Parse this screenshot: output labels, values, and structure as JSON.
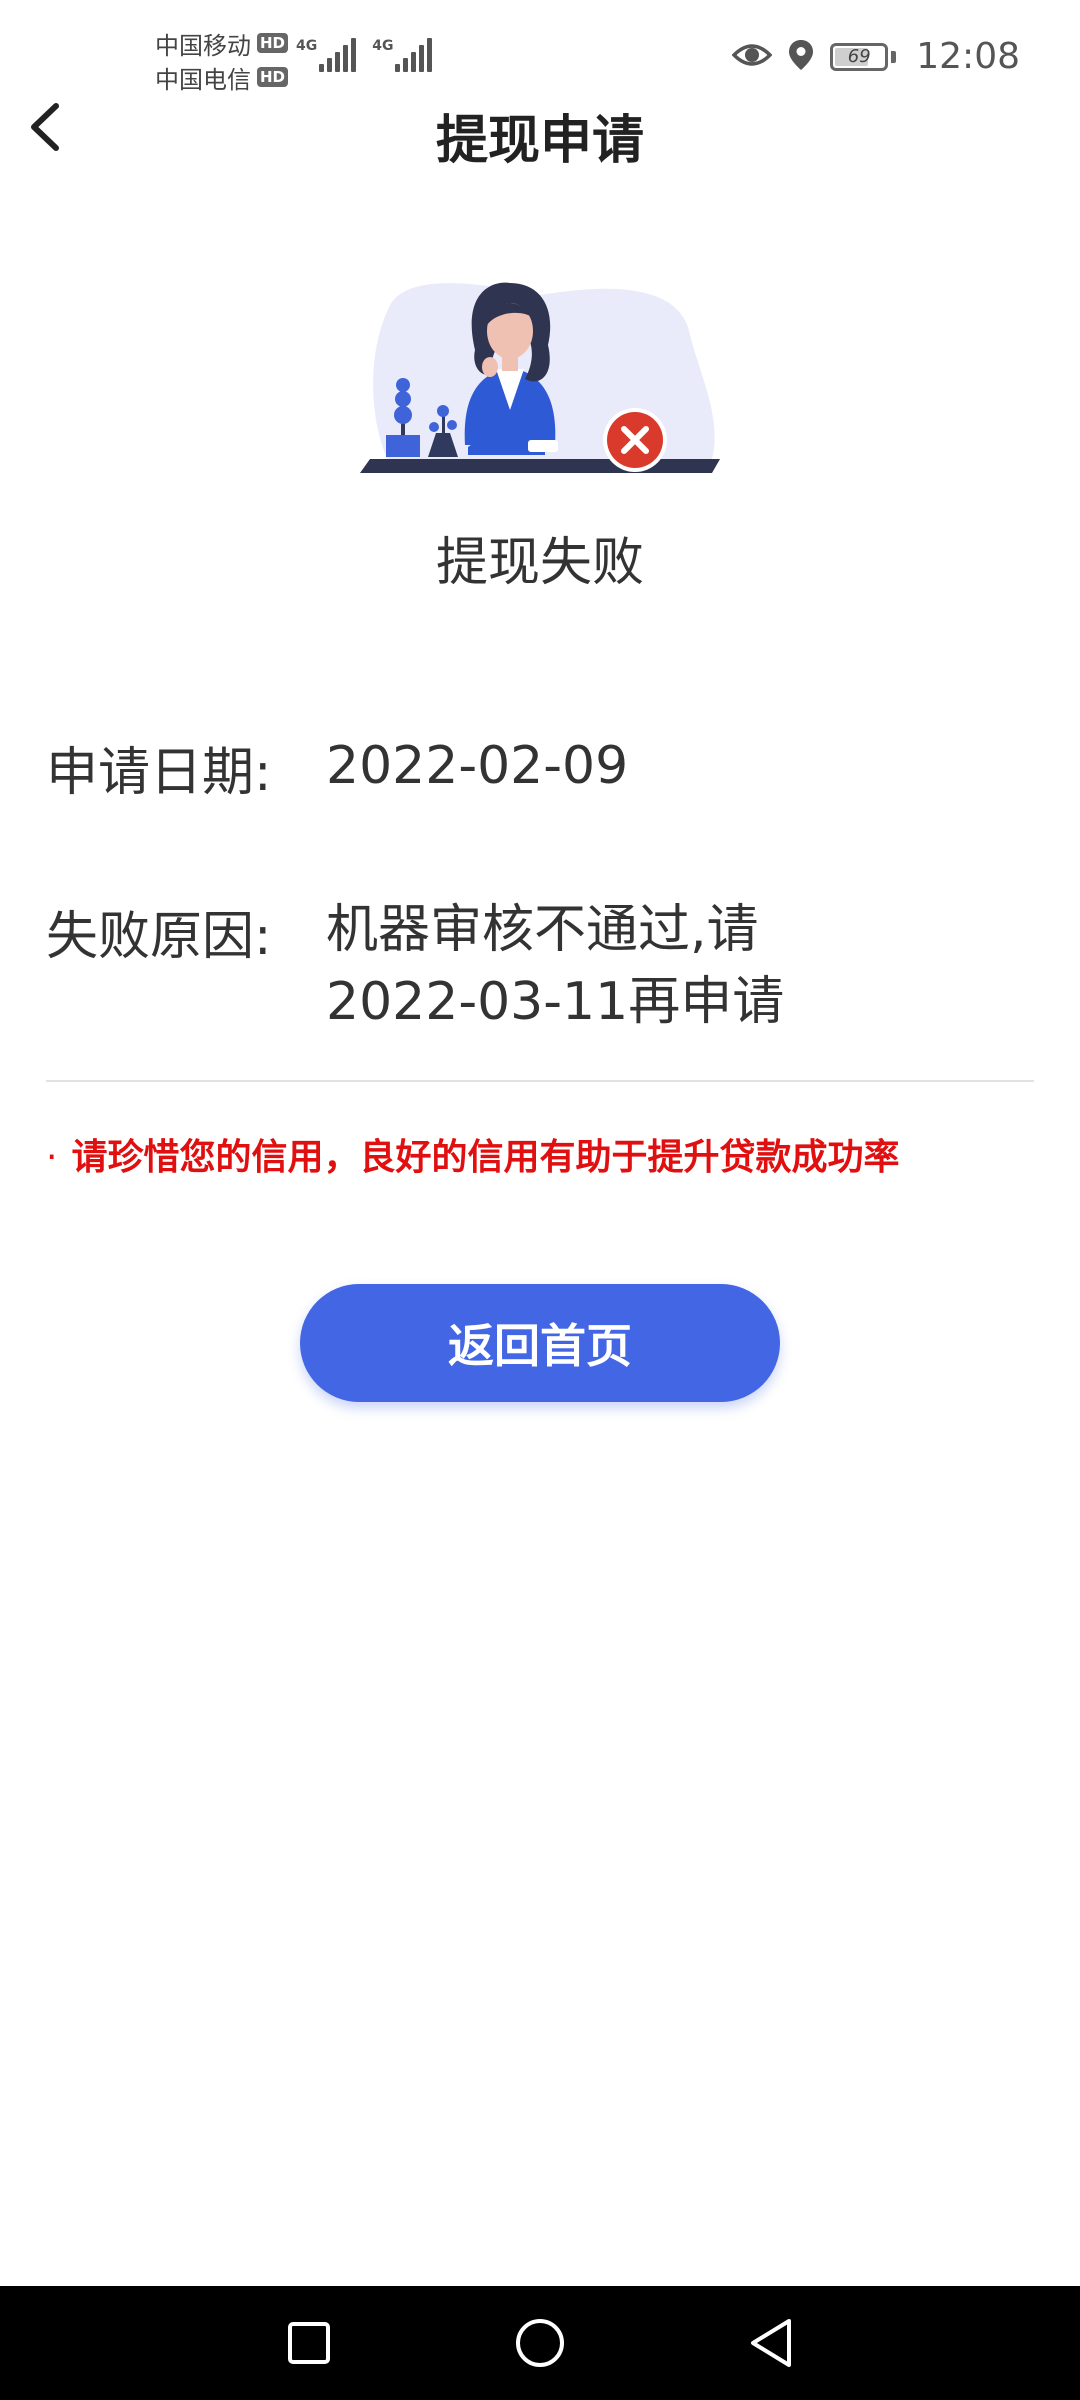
{
  "status_bar": {
    "carriers": [
      {
        "name": "中国移动",
        "badge": "HD",
        "tech": "4G"
      },
      {
        "name": "中国电信",
        "badge": "HD",
        "tech": "4G"
      }
    ],
    "battery_level": "69",
    "battery_fraction": 0.69,
    "time": "12:08",
    "icons": [
      "eye-icon",
      "location-icon",
      "battery-icon"
    ]
  },
  "header": {
    "title": "提现申请",
    "back_icon": "chevron-left-icon"
  },
  "result": {
    "title": "提现失败",
    "status_icon": "error-x-icon"
  },
  "details": {
    "date_label": "申请日期:",
    "date_value": "2022-02-09",
    "reason_label": "失败原因:",
    "reason_line1": "机器审核不通过,请",
    "reason_line2": "2022-03-11再申请"
  },
  "notice": {
    "bullet": "·",
    "text": "请珍惜您的信用，良好的信用有助于提升贷款成功率"
  },
  "actions": {
    "home_label": "返回首页"
  },
  "nav_bar": {
    "icons": [
      "recent-apps-icon",
      "home-icon",
      "back-triangle-icon"
    ]
  },
  "colors": {
    "accent": "#4266e4",
    "error": "#e01010",
    "error_badge": "#d93a2b",
    "text": "#333333"
  }
}
